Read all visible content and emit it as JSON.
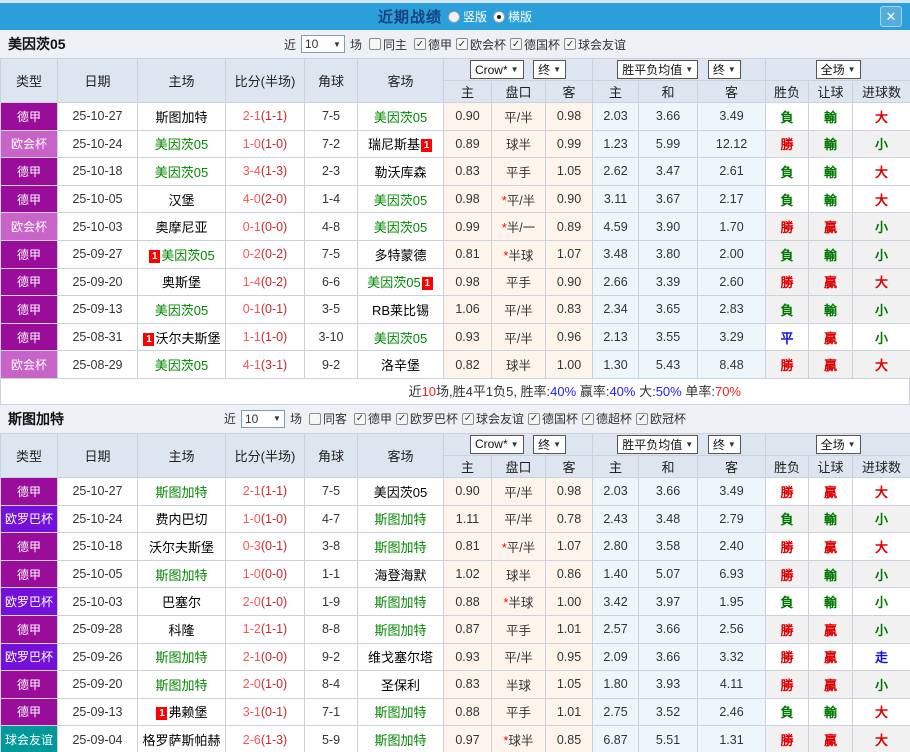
{
  "titlebar": {
    "title": "近期战绩",
    "radios": [
      {
        "label": "竖版",
        "selected": false
      },
      {
        "label": "横版",
        "selected": true
      }
    ],
    "close_icon": "✕"
  },
  "filter_labels": {
    "near": "近",
    "games": "场"
  },
  "table_header": {
    "type": "类型",
    "date": "日期",
    "home": "主场",
    "score": "比分(半场)",
    "corner": "角球",
    "away": "客场",
    "asian_select": "Crow*",
    "asian_final_select": "终",
    "euro_select": "胜平负均值",
    "euro_final_select": "终",
    "result_select": "全场",
    "sub_labels": [
      "主",
      "盘口",
      "客",
      "主",
      "和",
      "客",
      "胜负",
      "让球",
      "进球数"
    ]
  },
  "league_colors": {
    "德甲": "#9A0D9A",
    "欧会杯": "#C863C8",
    "欧罗巴杯": "#7311DB",
    "球会友谊": "#009898"
  },
  "result_colors": {
    "勝": "#DD0000",
    "負": "#007700",
    "平": "#1111DD",
    "贏": "#DD0000",
    "輸": "#007700",
    "走": "#1111DD",
    "大": "#DD0000",
    "小": "#007700"
  },
  "summary_colors": {
    "k": "#333333",
    "r": "#EE2222",
    "b": "#2222EE"
  },
  "colors": {
    "titlebar_bg": "#2B9FD9",
    "title_text": "#17427F",
    "close_btn_bg": "#57ACDE",
    "section_header_bg": "#EDF1F6",
    "table_header_bg": "#DDE5F0",
    "team_green": "#008800",
    "score_ft": "#FF5555",
    "score_ht": "#C62828",
    "asian_odds_bg": "#FDF5EC",
    "euro_odds_bg": "#EDF6FB",
    "shaded_result_bg": "#F1F1F1",
    "red_card_badge_bg": "#FF0000",
    "handicap_star": "#FF0000"
  },
  "sections": [
    {
      "team": "美因茨05",
      "filter": {
        "count": "10",
        "same_label": "同主",
        "same_checked": false,
        "leagues": [
          "德甲",
          "欧会杯",
          "德国杯",
          "球会友谊"
        ]
      },
      "rows": [
        {
          "league": "德甲",
          "date": "25-10-27",
          "home": "斯图加特",
          "home_green": false,
          "home_badge": "",
          "score_ft": "2-1",
          "score_ht": "(1-1)",
          "corner": "7-5",
          "away": "美因茨05",
          "away_green": true,
          "away_badge": "",
          "ah_home": "0.90",
          "ah_line": "平/半",
          "ah_away": "0.98",
          "eu_home": "2.03",
          "eu_draw": "3.66",
          "eu_away": "3.49",
          "wdl": "負",
          "handicap": "輸",
          "goals": "大",
          "shaded": false
        },
        {
          "league": "欧会杯",
          "date": "25-10-24",
          "home": "美因茨05",
          "home_green": true,
          "home_badge": "",
          "score_ft": "1-0",
          "score_ht": "(1-0)",
          "corner": "7-2",
          "away": "瑞尼斯基",
          "away_green": false,
          "away_badge": "1",
          "ah_home": "0.89",
          "ah_line": "球半",
          "ah_away": "0.99",
          "eu_home": "1.23",
          "eu_draw": "5.99",
          "eu_away": "12.12",
          "wdl": "勝",
          "handicap": "輸",
          "goals": "小",
          "shaded": true
        },
        {
          "league": "德甲",
          "date": "25-10-18",
          "home": "美因茨05",
          "home_green": true,
          "home_badge": "",
          "score_ft": "3-4",
          "score_ht": "(1-3)",
          "corner": "2-3",
          "away": "勒沃库森",
          "away_green": false,
          "away_badge": "",
          "ah_home": "0.83",
          "ah_line": "平手",
          "ah_away": "1.05",
          "eu_home": "2.62",
          "eu_draw": "3.47",
          "eu_away": "2.61",
          "wdl": "負",
          "handicap": "輸",
          "goals": "大",
          "shaded": false
        },
        {
          "league": "德甲",
          "date": "25-10-05",
          "home": "汉堡",
          "home_green": false,
          "home_badge": "",
          "score_ft": "4-0",
          "score_ht": "(2-0)",
          "corner": "1-4",
          "away": "美因茨05",
          "away_green": true,
          "away_badge": "",
          "ah_home": "0.98",
          "ah_line": "*平/半",
          "ah_away": "0.90",
          "eu_home": "3.11",
          "eu_draw": "3.67",
          "eu_away": "2.17",
          "wdl": "負",
          "handicap": "輸",
          "goals": "大",
          "shaded": false
        },
        {
          "league": "欧会杯",
          "date": "25-10-03",
          "home": "奥摩尼亚",
          "home_green": false,
          "home_badge": "",
          "score_ft": "0-1",
          "score_ht": "(0-0)",
          "corner": "4-8",
          "away": "美因茨05",
          "away_green": true,
          "away_badge": "",
          "ah_home": "0.99",
          "ah_line": "*半/一",
          "ah_away": "0.89",
          "eu_home": "4.59",
          "eu_draw": "3.90",
          "eu_away": "1.70",
          "wdl": "勝",
          "handicap": "贏",
          "goals": "小",
          "shaded": true
        },
        {
          "league": "德甲",
          "date": "25-09-27",
          "home": "美因茨05",
          "home_green": true,
          "home_badge": "1",
          "score_ft": "0-2",
          "score_ht": "(0-2)",
          "corner": "7-5",
          "away": "多特蒙德",
          "away_green": false,
          "away_badge": "",
          "ah_home": "0.81",
          "ah_line": "*半球",
          "ah_away": "1.07",
          "eu_home": "3.48",
          "eu_draw": "3.80",
          "eu_away": "2.00",
          "wdl": "負",
          "handicap": "輸",
          "goals": "小",
          "shaded": true
        },
        {
          "league": "德甲",
          "date": "25-09-20",
          "home": "奥斯堡",
          "home_green": false,
          "home_badge": "",
          "score_ft": "1-4",
          "score_ht": "(0-2)",
          "corner": "6-6",
          "away": "美因茨05",
          "away_green": true,
          "away_badge": "1",
          "ah_home": "0.98",
          "ah_line": "平手",
          "ah_away": "0.90",
          "eu_home": "2.66",
          "eu_draw": "3.39",
          "eu_away": "2.60",
          "wdl": "勝",
          "handicap": "贏",
          "goals": "大",
          "shaded": true
        },
        {
          "league": "德甲",
          "date": "25-09-13",
          "home": "美因茨05",
          "home_green": true,
          "home_badge": "",
          "score_ft": "0-1",
          "score_ht": "(0-1)",
          "corner": "3-5",
          "away": "RB莱比锡",
          "away_green": false,
          "away_badge": "",
          "ah_home": "1.06",
          "ah_line": "平/半",
          "ah_away": "0.83",
          "eu_home": "2.34",
          "eu_draw": "3.65",
          "eu_away": "2.83",
          "wdl": "負",
          "handicap": "輸",
          "goals": "小",
          "shaded": true
        },
        {
          "league": "德甲",
          "date": "25-08-31",
          "home": "沃尔夫斯堡",
          "home_green": false,
          "home_badge": "1",
          "score_ft": "1-1",
          "score_ht": "(1-0)",
          "corner": "3-10",
          "away": "美因茨05",
          "away_green": true,
          "away_badge": "",
          "ah_home": "0.93",
          "ah_line": "平/半",
          "ah_away": "0.96",
          "eu_home": "2.13",
          "eu_draw": "3.55",
          "eu_away": "3.29",
          "wdl": "平",
          "handicap": "贏",
          "goals": "小",
          "shaded": false
        },
        {
          "league": "欧会杯",
          "date": "25-08-29",
          "home": "美因茨05",
          "home_green": true,
          "home_badge": "",
          "score_ft": "4-1",
          "score_ht": "(3-1)",
          "corner": "9-2",
          "away": "洛辛堡",
          "away_green": false,
          "away_badge": "",
          "ah_home": "0.82",
          "ah_line": "球半",
          "ah_away": "1.00",
          "eu_home": "1.30",
          "eu_draw": "5.43",
          "eu_away": "8.48",
          "wdl": "勝",
          "handicap": "贏",
          "goals": "大",
          "shaded": true
        }
      ],
      "summary": [
        [
          "近",
          "k"
        ],
        [
          "10",
          "r"
        ],
        [
          "场,胜4平1负5, 胜率:",
          "k"
        ],
        [
          "40%",
          "b"
        ],
        [
          " 赢率:",
          "k"
        ],
        [
          "40%",
          "b"
        ],
        [
          " 大:",
          "k"
        ],
        [
          "50%",
          "b"
        ],
        [
          " 单率:",
          "k"
        ],
        [
          "70%",
          "r"
        ]
      ]
    },
    {
      "team": "斯图加特",
      "filter": {
        "count": "10",
        "same_label": "同客",
        "same_checked": false,
        "leagues": [
          "德甲",
          "欧罗巴杯",
          "球会友谊",
          "德国杯",
          "德超杯",
          "欧冠杯"
        ]
      },
      "rows": [
        {
          "league": "德甲",
          "date": "25-10-27",
          "home": "斯图加特",
          "home_green": true,
          "home_badge": "",
          "score_ft": "2-1",
          "score_ht": "(1-1)",
          "corner": "7-5",
          "away": "美因茨05",
          "away_green": false,
          "away_badge": "",
          "ah_home": "0.90",
          "ah_line": "平/半",
          "ah_away": "0.98",
          "eu_home": "2.03",
          "eu_draw": "3.66",
          "eu_away": "3.49",
          "wdl": "勝",
          "handicap": "贏",
          "goals": "大",
          "shaded": false
        },
        {
          "league": "欧罗巴杯",
          "date": "25-10-24",
          "home": "费内巴切",
          "home_green": false,
          "home_badge": "",
          "score_ft": "1-0",
          "score_ht": "(1-0)",
          "corner": "4-7",
          "away": "斯图加特",
          "away_green": true,
          "away_badge": "",
          "ah_home": "1.11",
          "ah_line": "平/半",
          "ah_away": "0.78",
          "eu_home": "2.43",
          "eu_draw": "3.48",
          "eu_away": "2.79",
          "wdl": "負",
          "handicap": "輸",
          "goals": "小",
          "shaded": true
        },
        {
          "league": "德甲",
          "date": "25-10-18",
          "home": "沃尔夫斯堡",
          "home_green": false,
          "home_badge": "",
          "score_ft": "0-3",
          "score_ht": "(0-1)",
          "corner": "3-8",
          "away": "斯图加特",
          "away_green": true,
          "away_badge": "",
          "ah_home": "0.81",
          "ah_line": "*平/半",
          "ah_away": "1.07",
          "eu_home": "2.80",
          "eu_draw": "3.58",
          "eu_away": "2.40",
          "wdl": "勝",
          "handicap": "贏",
          "goals": "大",
          "shaded": false
        },
        {
          "league": "德甲",
          "date": "25-10-05",
          "home": "斯图加特",
          "home_green": true,
          "home_badge": "",
          "score_ft": "1-0",
          "score_ht": "(0-0)",
          "corner": "1-1",
          "away": "海登海默",
          "away_green": false,
          "away_badge": "",
          "ah_home": "1.02",
          "ah_line": "球半",
          "ah_away": "0.86",
          "eu_home": "1.40",
          "eu_draw": "5.07",
          "eu_away": "6.93",
          "wdl": "勝",
          "handicap": "輸",
          "goals": "小",
          "shaded": true
        },
        {
          "league": "欧罗巴杯",
          "date": "25-10-03",
          "home": "巴塞尔",
          "home_green": false,
          "home_badge": "",
          "score_ft": "2-0",
          "score_ht": "(1-0)",
          "corner": "1-9",
          "away": "斯图加特",
          "away_green": true,
          "away_badge": "",
          "ah_home": "0.88",
          "ah_line": "*半球",
          "ah_away": "1.00",
          "eu_home": "3.42",
          "eu_draw": "3.97",
          "eu_away": "1.95",
          "wdl": "負",
          "handicap": "輸",
          "goals": "小",
          "shaded": false
        },
        {
          "league": "德甲",
          "date": "25-09-28",
          "home": "科隆",
          "home_green": false,
          "home_badge": "",
          "score_ft": "1-2",
          "score_ht": "(1-1)",
          "corner": "8-8",
          "away": "斯图加特",
          "away_green": true,
          "away_badge": "",
          "ah_home": "0.87",
          "ah_line": "平手",
          "ah_away": "1.01",
          "eu_home": "2.57",
          "eu_draw": "3.66",
          "eu_away": "2.56",
          "wdl": "勝",
          "handicap": "贏",
          "goals": "小",
          "shaded": true
        },
        {
          "league": "欧罗巴杯",
          "date": "25-09-26",
          "home": "斯图加特",
          "home_green": true,
          "home_badge": "",
          "score_ft": "2-1",
          "score_ht": "(0-0)",
          "corner": "9-2",
          "away": "维戈塞尔塔",
          "away_green": false,
          "away_badge": "",
          "ah_home": "0.93",
          "ah_line": "平/半",
          "ah_away": "0.95",
          "eu_home": "2.09",
          "eu_draw": "3.66",
          "eu_away": "3.32",
          "wdl": "勝",
          "handicap": "贏",
          "goals": "走",
          "shaded": false
        },
        {
          "league": "德甲",
          "date": "25-09-20",
          "home": "斯图加特",
          "home_green": true,
          "home_badge": "",
          "score_ft": "2-0",
          "score_ht": "(1-0)",
          "corner": "8-4",
          "away": "圣保利",
          "away_green": false,
          "away_badge": "",
          "ah_home": "0.83",
          "ah_line": "半球",
          "ah_away": "1.05",
          "eu_home": "1.80",
          "eu_draw": "3.93",
          "eu_away": "4.11",
          "wdl": "勝",
          "handicap": "贏",
          "goals": "小",
          "shaded": true
        },
        {
          "league": "德甲",
          "date": "25-09-13",
          "home": "弗赖堡",
          "home_green": false,
          "home_badge": "1",
          "score_ft": "3-1",
          "score_ht": "(0-1)",
          "corner": "7-1",
          "away": "斯图加特",
          "away_green": true,
          "away_badge": "",
          "ah_home": "0.88",
          "ah_line": "平手",
          "ah_away": "1.01",
          "eu_home": "2.75",
          "eu_draw": "3.52",
          "eu_away": "2.46",
          "wdl": "負",
          "handicap": "輸",
          "goals": "大",
          "shaded": false
        },
        {
          "league": "球会友谊",
          "date": "25-09-04",
          "home": "格罗萨斯帕赫",
          "home_green": false,
          "home_badge": "",
          "score_ft": "2-6",
          "score_ht": "(1-3)",
          "corner": "5-9",
          "away": "斯图加特",
          "away_green": true,
          "away_badge": "",
          "ah_home": "0.97",
          "ah_line": "*球半",
          "ah_away": "0.85",
          "eu_home": "6.87",
          "eu_draw": "5.51",
          "eu_away": "1.31",
          "wdl": "勝",
          "handicap": "贏",
          "goals": "大",
          "shaded": true
        }
      ],
      "summary": null
    }
  ]
}
